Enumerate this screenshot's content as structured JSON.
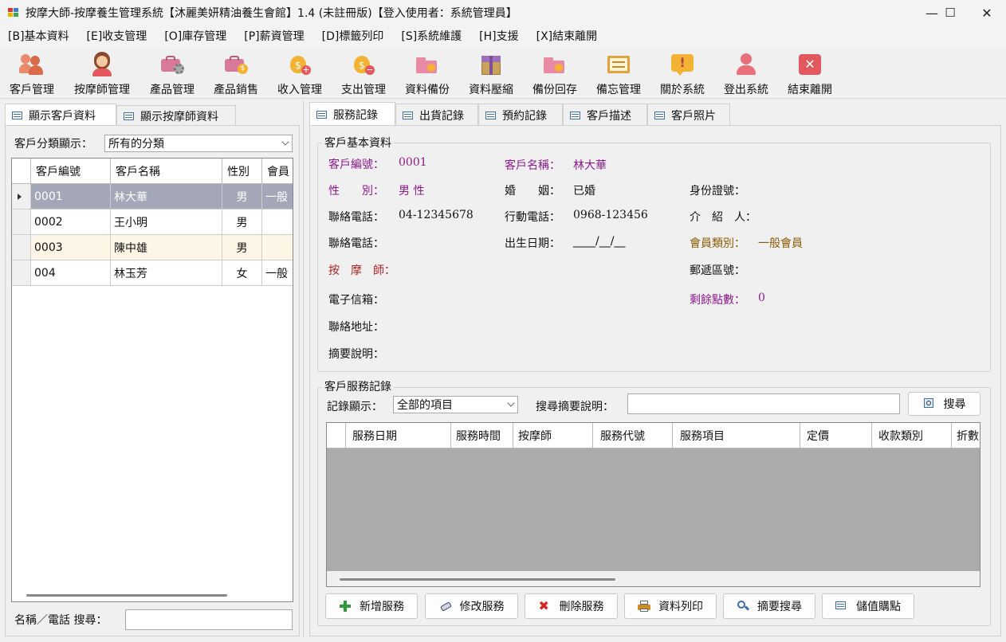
{
  "window": {
    "title": "按摩大師-按摩養生管理系統【沐麗美妍精油養生會館】1.4 (未註冊版)【登入使用者：系統管理員】",
    "minimize": "—",
    "maximize": "☐",
    "close": "✕"
  },
  "menu": [
    "[B]基本資料",
    "[E]收支管理",
    "[O]庫存管理",
    "[P]薪資管理",
    "[D]標籤列印",
    "[S]系統維護",
    "[H]支援",
    "[X]結束離開"
  ],
  "toolbar": [
    {
      "label": "客戶管理",
      "icon": "customers-icon"
    },
    {
      "label": "按摩師管理",
      "icon": "therapist-icon"
    },
    {
      "label": "產品管理",
      "icon": "product-gear-icon"
    },
    {
      "label": "產品銷售",
      "icon": "product-sale-icon"
    },
    {
      "label": "收入管理",
      "icon": "income-icon"
    },
    {
      "label": "支出管理",
      "icon": "expense-icon"
    },
    {
      "label": "資料備份",
      "icon": "backup-folder-icon"
    },
    {
      "label": "資料壓縮",
      "icon": "compress-box-icon"
    },
    {
      "label": "備份回存",
      "icon": "restore-folder-icon"
    },
    {
      "label": "備忘管理",
      "icon": "memo-board-icon"
    },
    {
      "label": "關於系統",
      "icon": "info-icon"
    },
    {
      "label": "登出系統",
      "icon": "logout-user-icon"
    },
    {
      "label": "結束離開",
      "icon": "exit-x-icon"
    }
  ],
  "left": {
    "tabs": [
      "顯示客戶資料",
      "顯示按摩師資料"
    ],
    "filter_label": "客戶分類顯示：",
    "filter_value": "所有的分類",
    "columns": [
      "客戶編號",
      "客戶名稱",
      "性別",
      "會員"
    ],
    "rows": [
      {
        "id": "0001",
        "name": "林大華",
        "gender": "男",
        "member": "一般"
      },
      {
        "id": "0002",
        "name": "王小明",
        "gender": "男",
        "member": ""
      },
      {
        "id": "0003",
        "name": "陳中雄",
        "gender": "男",
        "member": ""
      },
      {
        "id": "004",
        "name": "林玉芳",
        "gender": "女",
        "member": "一般"
      }
    ],
    "search_label": "名稱／電話 搜尋："
  },
  "right": {
    "tabs": [
      "服務記錄",
      "出貨記錄",
      "預約記錄",
      "客戶描述",
      "客戶照片"
    ],
    "basic_title": "客戶基本資料",
    "fields": {
      "cust_no_label": "客戶編號：",
      "cust_no": "0001",
      "cust_name_label": "客戶名稱：",
      "cust_name": "林大華",
      "gender_label": "性　　別：",
      "gender": "男 性",
      "marriage_label": "婚　　姻：",
      "marriage": "已婚",
      "idno_label": "身份證號：",
      "phone1_label": "聯絡電話：",
      "phone1": "04-12345678",
      "mobile_label": "行動電話：",
      "mobile": "0968-123456",
      "referrer_label": "介　紹　人：",
      "phone2_label": "聯絡電話：",
      "birthday_label": "出生日期：",
      "birthday": "____/__/__",
      "member_type_label": "會員類別：",
      "member_type": "一般會員",
      "therapist_label": "按　摩　師：",
      "zip_label": "郵遞區號：",
      "email_label": "電子信箱：",
      "points_label": "剩餘點數：",
      "points": "0",
      "address_label": "聯絡地址：",
      "memo_label": "摘要說明："
    },
    "service_title": "客戶服務記錄",
    "record_label": "記錄顯示：",
    "record_value": "全部的項目",
    "search_memo_label": "搜尋摘要說明：",
    "search_button": "搜尋",
    "columns": [
      "服務日期",
      "服務時間",
      "按摩師",
      "服務代號",
      "服務項目",
      "定價",
      "收款類別",
      "折數"
    ],
    "buttons": [
      "新增服務",
      "修改服務",
      "刪除服務",
      "資料列印",
      "摘要搜尋",
      "儲值購點"
    ]
  }
}
